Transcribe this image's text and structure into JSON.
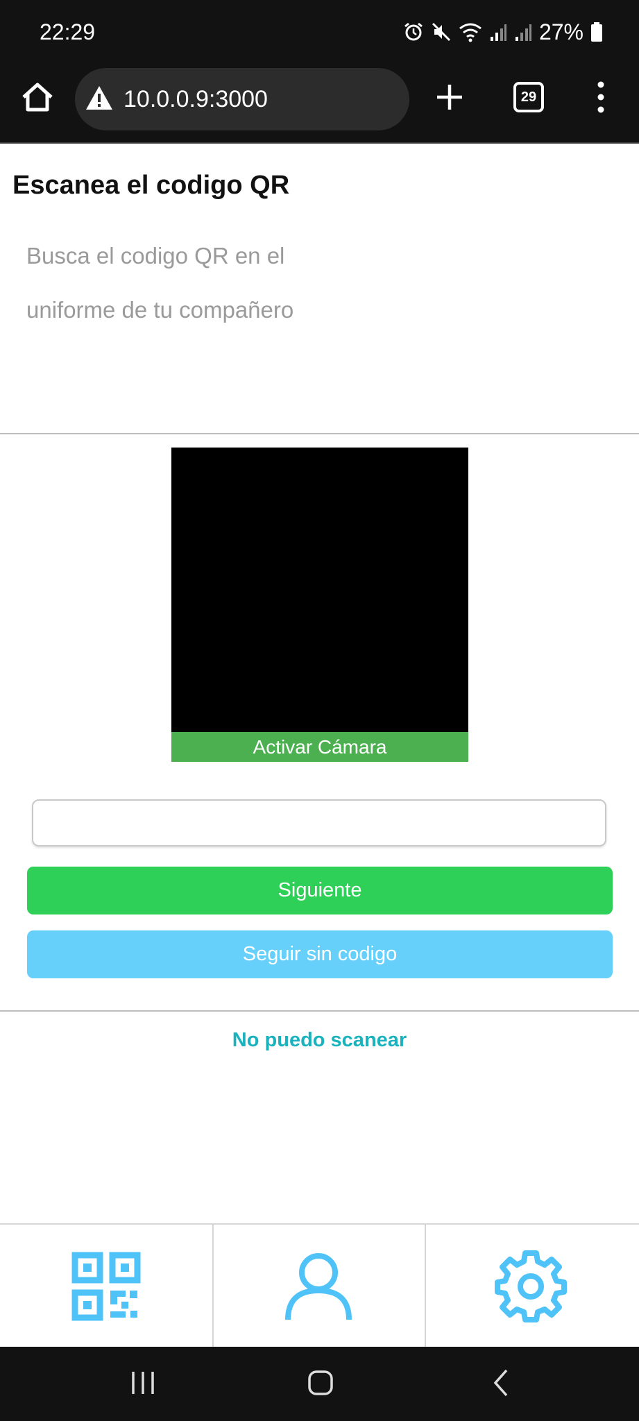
{
  "status_bar": {
    "time": "22:29",
    "battery": "27%"
  },
  "browser": {
    "url": "10.0.0.9:3000",
    "tab_count": "29"
  },
  "page": {
    "title": "Escanea el codigo QR",
    "subtitle": "Busca el codigo QR en el uniforme de tu compañero"
  },
  "camera": {
    "activate_label": "Activar Cámara"
  },
  "form": {
    "code_value": "",
    "next_label": "Siguiente",
    "skip_label": "Seguir sin codigo"
  },
  "help": {
    "cant_scan_label": "No puedo scanear"
  },
  "bottom_nav": {
    "items": [
      {
        "icon": "qr-code-icon"
      },
      {
        "icon": "user-icon"
      },
      {
        "icon": "gear-icon"
      }
    ]
  },
  "colors": {
    "accent_blue": "#4fc3f7",
    "next_green": "#2fd058",
    "skip_blue": "#66d0fb",
    "camera_green": "#4caf50",
    "link_teal": "#1ab3bd"
  }
}
